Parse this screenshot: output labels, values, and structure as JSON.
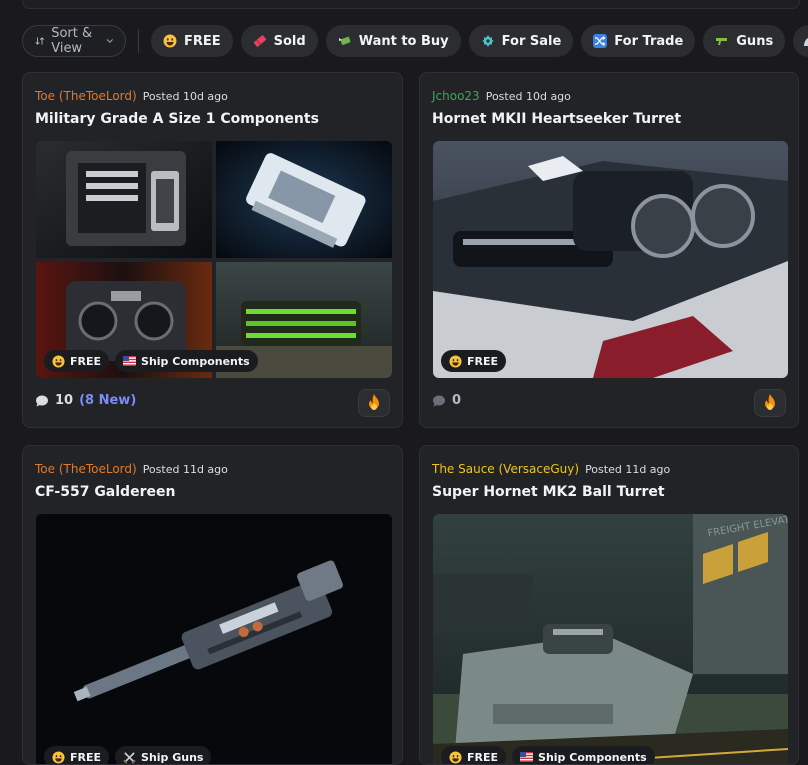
{
  "toolbar": {
    "sort_label": "Sort & View",
    "chips": [
      {
        "label": "FREE",
        "icon": "grinning-face-icon"
      },
      {
        "label": "Sold",
        "icon": "ticket-icon"
      },
      {
        "label": "Want to Buy",
        "icon": "money-wings-icon"
      },
      {
        "label": "For Sale",
        "icon": "sale-tag-icon"
      },
      {
        "label": "For Trade",
        "icon": "shuffle-icon"
      },
      {
        "label": "Guns",
        "icon": "pistol-icon"
      }
    ]
  },
  "posts": [
    {
      "author": "Toe (TheToeLord)",
      "author_color": "#e0792d",
      "posted": "Posted 10d ago",
      "title": "Military Grade A Size 1 Components",
      "tags": [
        "FREE",
        "Ship Components"
      ],
      "comments": "10",
      "new_comments": "(8 New)"
    },
    {
      "author": "Jchoo23",
      "author_color": "#3ba55c",
      "posted": "Posted 10d ago",
      "title": "Hornet MKII Heartseeker Turret",
      "tags": [
        "FREE"
      ],
      "comments": "0",
      "new_comments": ""
    },
    {
      "author": "Toe (TheToeLord)",
      "author_color": "#e0792d",
      "posted": "Posted 11d ago",
      "title": "CF-557 Galdereen",
      "tags": [
        "FREE",
        "Ship Guns"
      ]
    },
    {
      "author": "The Sauce (VersaceGuy)",
      "author_color": "#f0c419",
      "posted": "Posted 11d ago",
      "title": "Super Hornet MK2 Ball Turret",
      "tags": [
        "FREE",
        "Ship Components"
      ]
    }
  ],
  "image_text": "FREIGHT ELEVATOR"
}
